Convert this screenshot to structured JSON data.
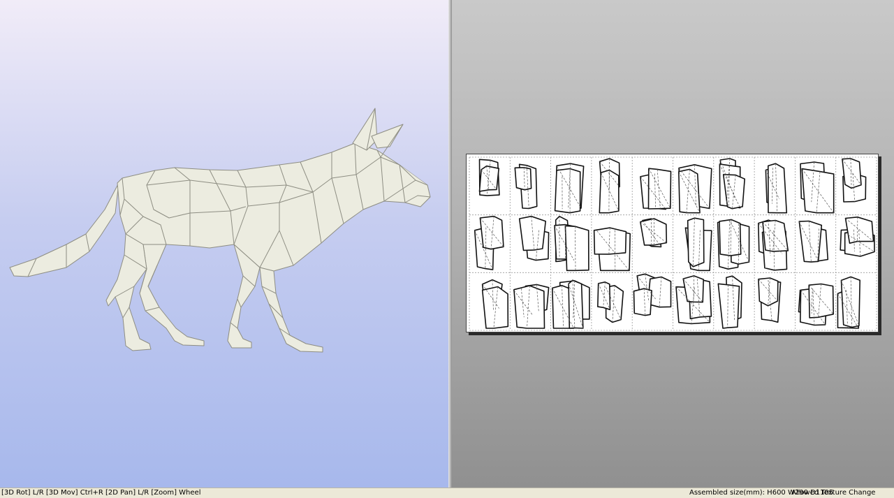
{
  "statusbar": {
    "controls_hint": "[3D Rot] L/R [3D Mov] Ctrl+R [2D Pan] L/R [Zoom] Wheel",
    "assembled_size": "Assembled size(mm): H600 W290 D1105",
    "texture_mode": "Allowed Texture Change"
  },
  "viewport3d": {
    "model": "low-poly-wolf",
    "bg_top": "#f1ecf8",
    "bg_bottom": "#a7b8ec"
  },
  "viewport2d": {
    "bg_top": "#c9c9c9",
    "bg_bottom": "#909090",
    "sheet": {
      "cols": 10,
      "rows": 3
    }
  },
  "colors": {
    "model_fill": "#ecece0",
    "model_edge": "#8b8b80",
    "part_edge": "#111111"
  }
}
